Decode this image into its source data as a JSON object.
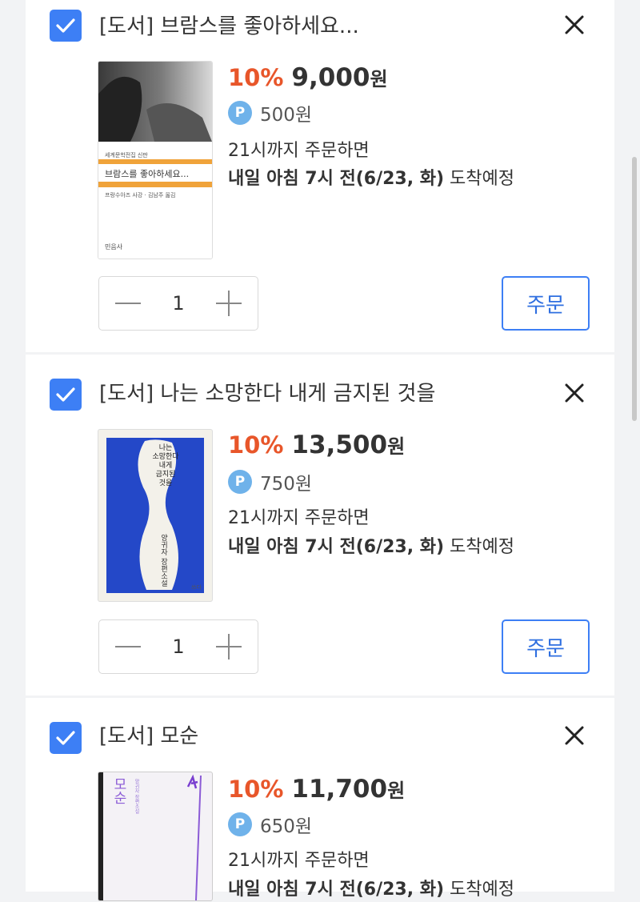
{
  "colors": {
    "accent": "#3d7ff5",
    "discount": "#e8562a",
    "point_badge": "#6fb2ea"
  },
  "icons": {
    "checkbox": "checkmark-icon",
    "remove": "close-icon",
    "point": "point-badge-icon",
    "minus": "minus-icon",
    "plus": "plus-icon"
  },
  "items": [
    {
      "title": "[도서] 브람스를 좋아하세요...",
      "discount": "10%",
      "price": "9,000",
      "price_unit": "원",
      "point_badge": "P",
      "points": "500원",
      "deadline": "21시까지 주문하면",
      "arrival_bold": "내일 아침 7시 전(6/23, 화)",
      "arrival_rest": " 도착예정",
      "quantity": "1",
      "order_label": "주문",
      "cover": {
        "publisher_line": "세계문학전집 신판",
        "title_text": "브람스를 좋아하세요...",
        "author_line": "프랑수아즈 사강 · 김남주 옮김",
        "imprint": "민음사"
      }
    },
    {
      "title": "[도서] 나는 소망한다 내게 금지된 것을",
      "discount": "10%",
      "price": "13,500",
      "price_unit": "원",
      "point_badge": "P",
      "points": "750원",
      "deadline": "21시까지 주문하면",
      "arrival_bold": "내일 아침 7시 전(6/23, 화)",
      "arrival_rest": " 도착예정",
      "quantity": "1",
      "order_label": "주문",
      "cover": {
        "title_lines": [
          "나는",
          "소망한다",
          "내게",
          "금지된",
          "것을"
        ],
        "author_vertical": "양귀자 장편소설",
        "imprint": "쓰다"
      }
    },
    {
      "title": "[도서] 모순",
      "discount": "10%",
      "price": "11,700",
      "price_unit": "원",
      "point_badge": "P",
      "points": "650원",
      "deadline": "21시까지 주문하면",
      "arrival_bold": "내일 아침 7시 전(6/23, 화)",
      "arrival_rest": " 도착예정",
      "cover": {
        "title_text": "모순",
        "author_vertical": "양귀자 장편소설"
      }
    }
  ]
}
